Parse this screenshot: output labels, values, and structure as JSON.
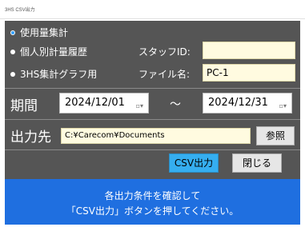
{
  "window": {
    "title": "3HS CSV出力"
  },
  "options": [
    {
      "label": "使用量集計",
      "selected": true
    },
    {
      "label": "個人別計量履歴",
      "selected": false
    },
    {
      "label": "3HS集計グラフ用",
      "selected": false
    }
  ],
  "staff": {
    "label": "スタッフID:",
    "value": ""
  },
  "file": {
    "label": "ファイル名:",
    "value": "PC-1"
  },
  "period": {
    "label": "期間",
    "start": "2024/12/01",
    "separator": "～",
    "end": "2024/12/31",
    "calendar_glyph": "▫▾"
  },
  "output": {
    "label": "出力先",
    "path": "C:¥Carecom¥Documents",
    "browse_label": "参照"
  },
  "buttons": {
    "csv_label": "CSV出力",
    "close_label": "閉じる"
  },
  "message": {
    "line1": "各出力条件を確認して",
    "line2": "「CSV出力」ボタンを押してください。"
  },
  "colors": {
    "panel": "#555555",
    "field_bg": "#fffbe0",
    "primary_button": "#35aef0",
    "banner": "#1f6fe0",
    "radio_selected": "#33a0ff"
  }
}
